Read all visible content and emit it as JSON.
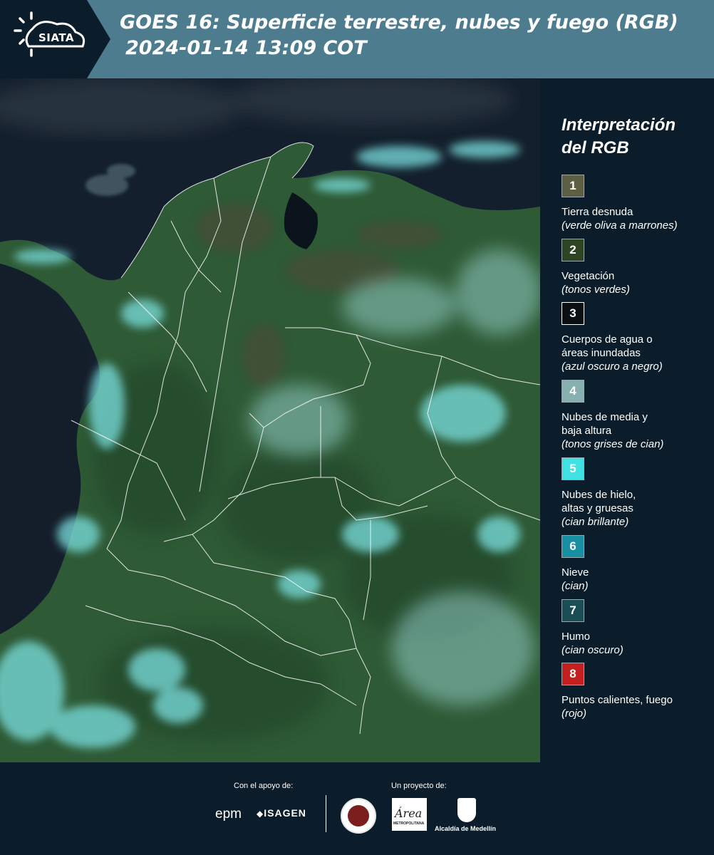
{
  "header": {
    "logo_text": "SIATA",
    "title_line1": "GOES 16: Superficie terrestre, nubes y fuego (RGB)",
    "title_line2": "2024-01-14 13:09 COT"
  },
  "legend": {
    "title": "Interpretación del RGB",
    "items": [
      {
        "num": "1",
        "label": "Tierra desnuda",
        "desc": "(verde oliva a marrones)",
        "color": "#5e5e44"
      },
      {
        "num": "2",
        "label": "Vegetación",
        "desc": "(tonos verdes)",
        "color": "#2d4523"
      },
      {
        "num": "3",
        "label": "Cuerpos de agua o áreas inundadas",
        "desc": "(azul oscuro a negro)",
        "color": "#0a0f14"
      },
      {
        "num": "4",
        "label": "Nubes de media y baja altura",
        "desc": "(tonos grises de cian)",
        "color": "#88b0b0"
      },
      {
        "num": "5",
        "label": "Nubes de hielo, altas y gruesas",
        "desc": "(cian brillante)",
        "color": "#3ee2e2"
      },
      {
        "num": "6",
        "label": "Nieve",
        "desc": "(cian)",
        "color": "#188fa3"
      },
      {
        "num": "7",
        "label": "Humo",
        "desc": "(cian oscuro)",
        "color": "#1a4d55"
      },
      {
        "num": "8",
        "label": "Puntos calientes, fuego",
        "desc": "(rojo)",
        "color": "#c4201f"
      }
    ]
  },
  "footer": {
    "support_label": "Con el apoyo de:",
    "project_label": "Un proyecto de:",
    "epm": "epm",
    "isagen": "ISAGEN",
    "metro": "Área",
    "metro_sub": "METROPOLITANA",
    "alcaldia": "Alcaldía de Medellín"
  },
  "colors": {
    "header_bg": "#4d7c8f",
    "page_bg": "#0b1d2a",
    "ocean": "#122130",
    "vegetation": "#2f5a34",
    "cloud": "#7fe0e0"
  }
}
